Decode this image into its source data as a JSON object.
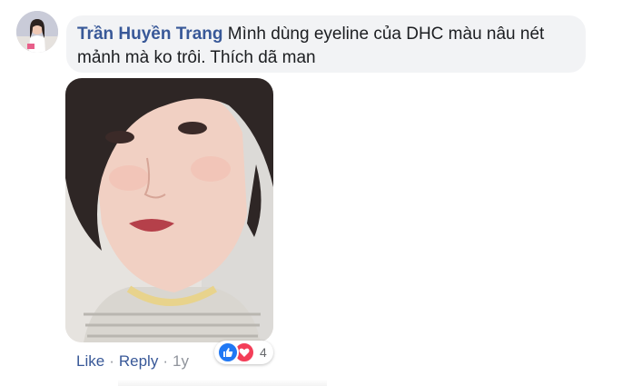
{
  "comment": {
    "author": "Trần Huyền Trang",
    "text": " Mình dùng eyeline của DHC màu nâu nét mảnh mà ko trôi. Thích dã man"
  },
  "reactions": {
    "icons": [
      "like-icon",
      "love-icon"
    ],
    "count": "4"
  },
  "actions": {
    "like_label": "Like",
    "reply_label": "Reply",
    "separator": "·",
    "timestamp": "1y"
  },
  "colors": {
    "author_link": "#385898",
    "bubble_bg": "#f2f3f5",
    "like_blue": "#2078f4",
    "love_red": "#f33e58",
    "meta_gray": "#90949c"
  }
}
